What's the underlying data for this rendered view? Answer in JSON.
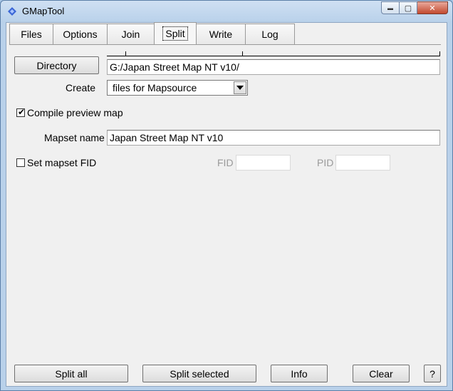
{
  "window": {
    "title": "GMapTool"
  },
  "titlebar": {
    "min_glyph": "▬",
    "max_glyph": "▢",
    "close_glyph": "✕"
  },
  "tabs": [
    {
      "label": "Files"
    },
    {
      "label": "Options"
    },
    {
      "label": "Join"
    },
    {
      "label": "Split"
    },
    {
      "label": "Write"
    },
    {
      "label": "Log"
    }
  ],
  "active_tab": "Split",
  "split": {
    "directory_button": "Directory",
    "directory_value": "G:/Japan Street Map NT v10/",
    "create_label": "Create",
    "create_selected": "files for Mapsource",
    "compile_preview": {
      "label": "Compile preview map",
      "checked": true,
      "mark": "✔"
    },
    "mapset_name_label": "Mapset name",
    "mapset_name_value": "Japan Street Map NT v10",
    "set_fid": {
      "label": "Set mapset FID",
      "checked": false
    },
    "fid_label": "FID",
    "fid_value": "",
    "pid_label": "PID",
    "pid_value": ""
  },
  "bottom": {
    "split_all": "Split all",
    "split_selected": "Split selected",
    "info": "Info",
    "clear": "Clear",
    "help": "?"
  },
  "icons": {
    "app": "diamond-icon",
    "dropdown": "triangle-down-icon"
  },
  "colors": {
    "app_icon": "#3b66d6",
    "close_button": "#c2492f"
  }
}
